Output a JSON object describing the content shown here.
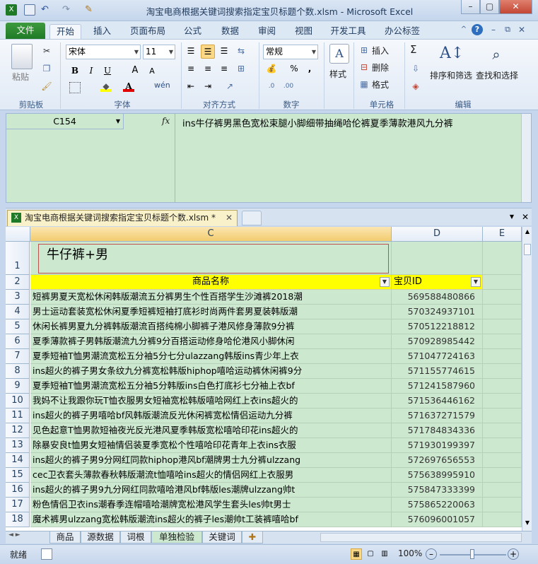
{
  "window": {
    "title": "淘宝电商根据关键词搜索指定宝贝标题个数.xlsm - Microsoft Excel"
  },
  "ribbon_tabs": [
    "文件",
    "开始",
    "插入",
    "页面布局",
    "公式",
    "数据",
    "审阅",
    "视图",
    "开发工具",
    "办公标签"
  ],
  "ribbon": {
    "clipboard": {
      "paste": "粘贴",
      "label": "剪贴板"
    },
    "font": {
      "name": "宋体",
      "size": "11",
      "label": "字体",
      "increase": "A",
      "decrease": "A",
      "wen": "wén"
    },
    "alignment": {
      "label": "对齐方式"
    },
    "number": {
      "format": "常规",
      "label": "数字",
      "percent": "%",
      "comma": ","
    },
    "styles": {
      "label": "样式"
    },
    "cells": {
      "insert": "插入",
      "delete": "删除",
      "format": "格式",
      "label": "单元格"
    },
    "editing": {
      "sum": "Σ",
      "sort": "排序和筛选",
      "find": "查找和选择",
      "label": "编辑"
    }
  },
  "formula_bar": {
    "name_box": "C154",
    "fx": "fx",
    "content": "ins牛仔裤男黑色宽松束腿小脚细带抽绳哈伦裤夏季薄款港风九分裤"
  },
  "workbook_tab": "淘宝电商根据关键词搜索指定宝贝标题个数.xlsm *",
  "grid": {
    "columns": [
      "C",
      "D",
      "E"
    ],
    "keyword_box": "牛仔裤+男",
    "header": {
      "name": "商品名称",
      "id": "宝贝ID"
    },
    "rows": [
      {
        "num": "1"
      },
      {
        "num": "2"
      },
      {
        "num": "3",
        "name": "短裤男夏天宽松休闲韩版潮流五分裤男生个性百搭学生沙滩裤2018潮",
        "id": "569588480866"
      },
      {
        "num": "4",
        "name": "男士运动套装宽松休闲夏季短裤短袖打底衫时尚两件套男夏装韩版潮",
        "id": "570324937101"
      },
      {
        "num": "5",
        "name": "休闲长裤男夏九分裤韩版潮流百搭纯棉小脚裤子港风修身薄款9分裤",
        "id": "570512218812"
      },
      {
        "num": "6",
        "name": "夏季薄款裤子男韩版潮流九分裤9分百搭运动修身哈伦港风小脚休闲",
        "id": "570928985442"
      },
      {
        "num": "7",
        "name": "夏季短袖T恤男潮流宽松五分袖5分七分ulazzang韩版ins青少年上衣",
        "id": "571047724163"
      },
      {
        "num": "8",
        "name": "ins超火的裤子男女条纹九分裤宽松韩版hiphop嘻哈运动裤休闲裤9分",
        "id": "571155774615"
      },
      {
        "num": "9",
        "name": "夏季短袖T恤男潮流宽松五分袖5分韩版ins白色打底衫七分袖上衣bf",
        "id": "571241587960"
      },
      {
        "num": "10",
        "name": "我妈不让我跟你玩T恤衣服男女短袖宽松韩版嘻哈网红上衣ins超火的",
        "id": "571536446162"
      },
      {
        "num": "11",
        "name": "ins超火的裤子男嘻哈bf风韩版潮流反光休闲裤宽松情侣运动九分裤",
        "id": "571637271579"
      },
      {
        "num": "12",
        "name": "见色起意T恤男款短袖夜光反光港风夏季韩版宽松嘻哈印花ins超火的",
        "id": "571784834336"
      },
      {
        "num": "13",
        "name": "除暴安良t恤男女短袖情侣装夏季宽松个性嘻哈印花青年上衣ins衣服",
        "id": "571930199397"
      },
      {
        "num": "14",
        "name": "ins超火的裤子男9分网红同款hiphop港风bf潮牌男士九分裤ulzzang",
        "id": "572697656553"
      },
      {
        "num": "15",
        "name": "cec卫衣套头薄款春秋韩版潮流t恤嘻哈ins超火的情侣网红上衣服男",
        "id": "575638995910"
      },
      {
        "num": "16",
        "name": "ins超火的裤子男9九分网红同款嘻哈港风bf韩版les潮牌ulzzang帅t",
        "id": "575847333399"
      },
      {
        "num": "17",
        "name": "粉色情侣卫衣ins潮春季连帽嘻哈潮牌宽松港风学生套头les帅t男士",
        "id": "575865220063"
      },
      {
        "num": "18",
        "name": "魔术裤男ulzzang宽松韩版潮流ins超火的裤子les潮帅t工装裤嘻哈bf",
        "id": "576096001057"
      }
    ]
  },
  "sheet_tabs": [
    "商品",
    "源数据",
    "词根",
    "单独检验",
    "关键词"
  ],
  "status": {
    "ready": "就绪",
    "zoom": "100%"
  }
}
